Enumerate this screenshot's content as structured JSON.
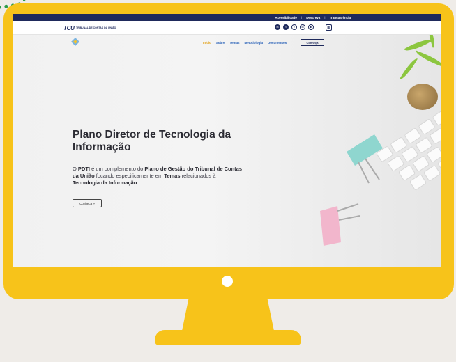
{
  "topbar": {
    "accessibility": "Acessibilidade",
    "search": "Descreva",
    "transparency": "Transparência"
  },
  "brand": {
    "logo": "TCU",
    "name": "TRIBUNAL DE CONTAS DA UNIÃO"
  },
  "social": [
    {
      "name": "tumblr-icon",
      "glyph": "✉"
    },
    {
      "name": "twitter-icon",
      "glyph": "t"
    },
    {
      "name": "facebook-icon",
      "glyph": "f"
    },
    {
      "name": "linkedin-icon",
      "glyph": "in"
    },
    {
      "name": "youtube-icon",
      "glyph": "▶"
    }
  ],
  "nav": {
    "items": [
      "Início",
      "Sobre",
      "Temas",
      "Metodologia",
      "Documentos"
    ],
    "active": "Início",
    "cta": "Conheça"
  },
  "hero": {
    "title": "Plano Diretor de Tecnologia da Informação",
    "text_parts": [
      {
        "t": "O ",
        "b": false
      },
      {
        "t": "PDTI",
        "b": true
      },
      {
        "t": " é um complemento do ",
        "b": false
      },
      {
        "t": "Plano de Gestão do Tribunal de Contas da União",
        "b": true
      },
      {
        "t": " focando especificamente em ",
        "b": false
      },
      {
        "t": "Temas",
        "b": true
      },
      {
        "t": " relacionados à ",
        "b": false
      },
      {
        "t": "Tecnologia da Informação",
        "b": true
      },
      {
        "t": ".",
        "b": false
      }
    ],
    "button": "Conheça »"
  },
  "colors": {
    "frame": "#f7c31a",
    "navy": "#1f2a5c",
    "link": "#2a62b8",
    "active": "#e2a21a"
  }
}
